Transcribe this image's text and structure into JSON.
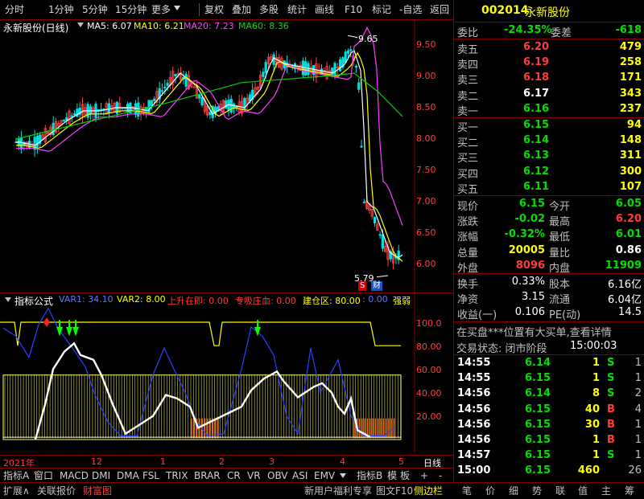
{
  "toolbar": {
    "items": [
      "分时",
      "1分钟",
      "5分钟",
      "15分钟",
      "更多",
      "复权",
      "叠加",
      "多股",
      "统计",
      "画线",
      "F10",
      "标记",
      "-自选",
      "返回"
    ]
  },
  "main_chart": {
    "stock_title": "永新股份(日线)",
    "ma5": "MA5: 6.07",
    "ma10": "MA10: 6.21",
    "ma20": "MA20: 7.23",
    "ma60": "MA60: 8.36",
    "high_label": "9.65",
    "low_label": "5.79",
    "y_ticks": [
      "9.50",
      "9.00",
      "8.50",
      "8.00",
      "7.50",
      "7.00",
      "6.50",
      "6.00"
    ],
    "marker_s": "S",
    "marker_cai": "财"
  },
  "indicator": {
    "name": "指标公式",
    "var1": "VAR1: 34.10",
    "var2": "VAR2: 8.00",
    "l1": "上升在即: 0.00",
    "l2": "专吸庄血: 0.00",
    "l3": "建仓区: 80.00",
    "l4": ": 0.00",
    "l5": "强弱",
    "y_ticks": [
      "100.0",
      "80.00",
      "60.00",
      "40.00",
      "20.00"
    ]
  },
  "time_axis": {
    "labels": [
      "2021年",
      "12",
      "1",
      "2",
      "3",
      "4",
      "5"
    ],
    "right": "日线"
  },
  "bottom_tabs": [
    "指标A",
    "窗口",
    "MACD",
    "DMI",
    "DMA",
    "FSL",
    "TRIX",
    "BRAR",
    "CR",
    "VR",
    "OBV",
    "ASI",
    "EMV"
  ],
  "bottom_tabs_right": [
    "指标B",
    "模",
    "板",
    "+",
    "-"
  ],
  "footer": {
    "left": [
      "扩展∧",
      "关联报价",
      "财富图"
    ],
    "mid": [
      "新用户福利专享",
      "图文F10",
      "侧边栏"
    ],
    "right": [
      "笔",
      "价",
      "细",
      "势",
      "联",
      "值",
      "主",
      "筹"
    ]
  },
  "quote": {
    "code": "002014",
    "name": "永新股份",
    "weibi_label": "委比",
    "weibi": "-24.35%",
    "weicha_label": "委差",
    "weicha": "-618",
    "sell": [
      {
        "label": "卖五",
        "price": "6.20",
        "vol": "479"
      },
      {
        "label": "卖四",
        "price": "6.19",
        "vol": "258"
      },
      {
        "label": "卖三",
        "price": "6.18",
        "vol": "171"
      },
      {
        "label": "卖二",
        "price": "6.17",
        "vol": "343"
      },
      {
        "label": "卖一",
        "price": "6.16",
        "vol": "237"
      }
    ],
    "buy": [
      {
        "label": "买一",
        "price": "6.15",
        "vol": "94"
      },
      {
        "label": "买二",
        "price": "6.14",
        "vol": "148"
      },
      {
        "label": "买三",
        "price": "6.13",
        "vol": "311"
      },
      {
        "label": "买四",
        "price": "6.12",
        "vol": "300"
      },
      {
        "label": "买五",
        "price": "6.11",
        "vol": "107"
      }
    ],
    "stats": [
      {
        "l1": "现价",
        "v1": "6.15",
        "l2": "今开",
        "v2": "6.05"
      },
      {
        "l1": "涨跌",
        "v1": "-0.02",
        "l2": "最高",
        "v2": "6.20"
      },
      {
        "l1": "涨幅",
        "v1": "-0.32%",
        "l2": "最低",
        "v2": "6.01"
      },
      {
        "l1": "总量",
        "v1": "20005",
        "l2": "量比",
        "v2": "0.86"
      },
      {
        "l1": "外盘",
        "v1": "8096",
        "l2": "内盘",
        "v2": "11909"
      }
    ],
    "finance": [
      {
        "l1": "换手",
        "v1": "0.33%",
        "l2": "股本",
        "v2": "6.16亿"
      },
      {
        "l1": "净资",
        "v1": "3.15",
        "l2": "流通",
        "v2": "6.04亿"
      },
      {
        "l1": "收益(一)",
        "v1": "0.106",
        "l2": "PE(动)",
        "v2": "14.5"
      }
    ],
    "notice": "在买盘***位置有大买单,查看详情",
    "status_label": "交易状态: 闭市阶段",
    "status_time": "15:00:03",
    "ticks": [
      {
        "t": "14:55",
        "p": "6.14",
        "v": "1",
        "d": "S",
        "n": "1"
      },
      {
        "t": "14:55",
        "p": "6.15",
        "v": "1",
        "d": "S",
        "n": "1"
      },
      {
        "t": "14:56",
        "p": "6.14",
        "v": "8",
        "d": "S",
        "n": "2"
      },
      {
        "t": "14:56",
        "p": "6.15",
        "v": "40",
        "d": "B",
        "n": "4"
      },
      {
        "t": "14:56",
        "p": "6.15",
        "v": "30",
        "d": "B",
        "n": "1"
      },
      {
        "t": "14:56",
        "p": "6.15",
        "v": "1",
        "d": "B",
        "n": "1"
      },
      {
        "t": "14:57",
        "p": "6.15",
        "v": "1",
        "d": "S",
        "n": "1"
      },
      {
        "t": "15:00",
        "p": "6.15",
        "v": "460",
        "d": "",
        "n": "26"
      }
    ]
  }
}
